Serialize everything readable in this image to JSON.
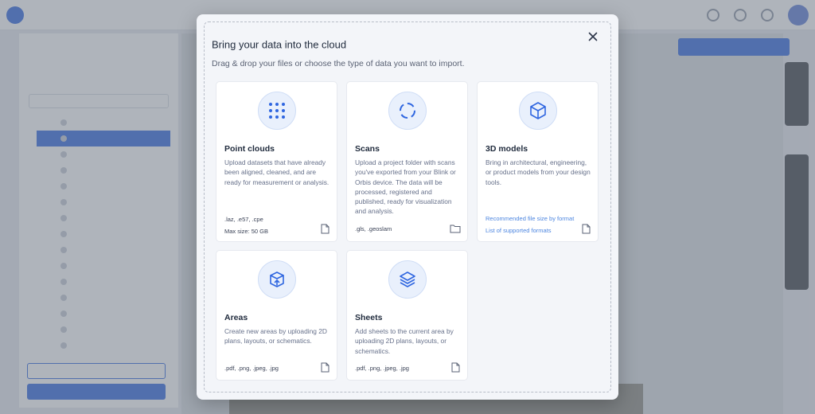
{
  "background": {
    "accent": "#2f66e0"
  },
  "modal": {
    "title": "Bring your data into the cloud",
    "subtitle": "Drag & drop your files or choose the type of data you want to import.",
    "close_icon": "close-icon",
    "cards": [
      {
        "id": "point-clouds",
        "icon": "grid-dots-icon",
        "title": "Point clouds",
        "description": "Upload datasets that have already been aligned, cleaned, and are ready for measurement or analysis.",
        "formats": ".laz, .e57, .cpe",
        "max_size": "Max size: 50 GB",
        "action_icon": "file-icon"
      },
      {
        "id": "scans",
        "icon": "dashed-circle-icon",
        "title": "Scans",
        "description": "Upload a project folder with scans you've exported from your Blink or Orbis device. The data will be processed, registered and published, ready for visualization and analysis.",
        "formats": ".gls, .geoslam",
        "action_icon": "folder-icon"
      },
      {
        "id": "3d-models",
        "icon": "cube-icon",
        "title": "3D models",
        "description": "Bring in architectural, engineering, or product models from your design tools.",
        "links": [
          "Recommended file size by format",
          "List of supported formats"
        ],
        "action_icon": "file-icon"
      },
      {
        "id": "areas",
        "icon": "box-upload-icon",
        "title": "Areas",
        "description": "Create new areas by uploading 2D plans, layouts, or schematics.",
        "formats": ".pdf, .png, .jpeg, .jpg",
        "action_icon": "file-icon"
      },
      {
        "id": "sheets",
        "icon": "layers-icon",
        "title": "Sheets",
        "description": "Add sheets to the current area by uploading 2D plans, layouts, or schematics.",
        "formats": ".pdf, .png, .jpeg, .jpg",
        "action_icon": "file-icon"
      }
    ]
  }
}
